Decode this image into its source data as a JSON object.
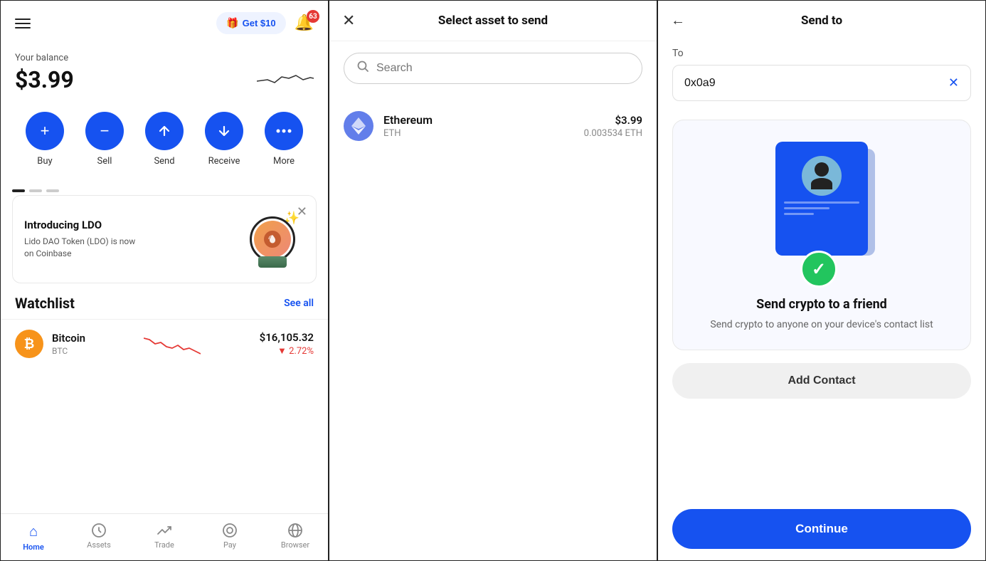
{
  "left": {
    "header": {
      "get_label": "Get $10",
      "badge_count": "63"
    },
    "balance": {
      "label": "Your balance",
      "amount": "$3.99"
    },
    "actions": [
      {
        "id": "buy",
        "label": "Buy",
        "icon": "+"
      },
      {
        "id": "sell",
        "label": "Sell",
        "icon": "−"
      },
      {
        "id": "send",
        "label": "Send",
        "icon": "↑"
      },
      {
        "id": "receive",
        "label": "Receive",
        "icon": "↓"
      },
      {
        "id": "more",
        "label": "More",
        "icon": "•••"
      }
    ],
    "promo": {
      "title": "Introducing LDO",
      "description": "Lido DAO Token (LDO) is now on Coinbase"
    },
    "watchlist": {
      "title": "Watchlist",
      "see_all": "See all",
      "items": [
        {
          "name": "Bitcoin",
          "symbol": "BTC",
          "price": "$16,105.32",
          "change": "▼ 2.72%",
          "negative": true
        }
      ]
    },
    "nav": [
      {
        "id": "home",
        "label": "Home",
        "icon": "🏠",
        "active": true
      },
      {
        "id": "assets",
        "label": "Assets",
        "icon": "⏱",
        "active": false
      },
      {
        "id": "trade",
        "label": "Trade",
        "icon": "📈",
        "active": false
      },
      {
        "id": "pay",
        "label": "Pay",
        "icon": "⊙",
        "active": false
      },
      {
        "id": "browser",
        "label": "Browser",
        "icon": "🌐",
        "active": false
      }
    ]
  },
  "middle": {
    "header": {
      "title": "Select asset to send",
      "close_icon": "✕"
    },
    "search": {
      "placeholder": "Search"
    },
    "assets": [
      {
        "name": "Ethereum",
        "symbol": "ETH",
        "usd_value": "$3.99",
        "crypto_value": "0.003534 ETH"
      }
    ]
  },
  "right": {
    "header": {
      "title": "Send to",
      "back_icon": "←"
    },
    "to_label": "To",
    "to_value": "0x0a9",
    "friend_card": {
      "title": "Send crypto to a friend",
      "description": "Send crypto to anyone on your device's contact list"
    },
    "add_contact_label": "Add Contact",
    "continue_label": "Continue"
  }
}
